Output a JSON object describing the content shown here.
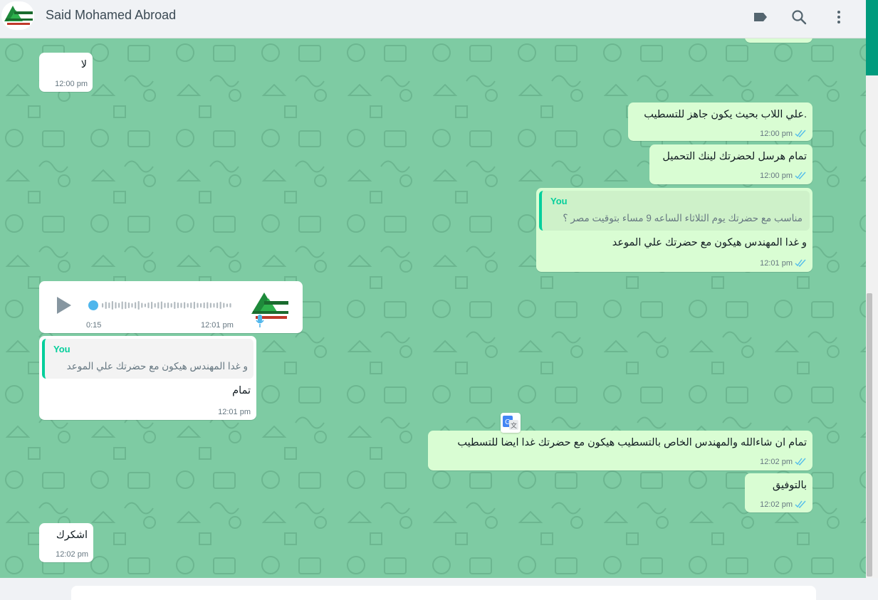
{
  "header": {
    "contact_name": "Said Mohamed Abroad",
    "icons": [
      "label-icon",
      "search-icon",
      "menu-icon"
    ]
  },
  "messages": [
    {
      "dir": "in",
      "text": "لا",
      "time": "12:00 pm"
    },
    {
      "dir": "out",
      "text": ".علي اللاب بحيث يكون جاهز للتسطيب",
      "time": "12:00 pm",
      "status": "read"
    },
    {
      "dir": "out",
      "text": "تمام هرسل لحضرتك لينك التحميل",
      "time": "12:00 pm",
      "status": "read"
    },
    {
      "dir": "out",
      "quote_author": "You",
      "quote_text": "مناسب مع حضرتك يوم الثلاثاء الساعه 9 مساء بتوقيت مصر ؟",
      "text": "و غدا المهندس هيكون مع حضرتك علي الموعد",
      "time": "12:01 pm",
      "status": "read"
    },
    {
      "dir": "in",
      "type": "voice",
      "duration": "0:15",
      "time": "12:01 pm"
    },
    {
      "dir": "in",
      "quote_author": "You",
      "quote_text": "و غدا المهندس هيكون مع حضرتك علي الموعد",
      "text": "تمام",
      "time": "12:01 pm"
    },
    {
      "dir": "out",
      "text": "تمام ان شاءالله والمهندس الخاص بالتسطيب هيكون مع حضرتك غدا ايضا للتسطيب",
      "time": "12:02 pm",
      "status": "read"
    },
    {
      "dir": "out",
      "text": "بالتوفيق",
      "time": "12:02 pm",
      "status": "read"
    },
    {
      "dir": "in",
      "text": "اشكرك",
      "time": "12:02 pm"
    }
  ],
  "colors": {
    "chat_bg": "#7ecba3",
    "outgoing": "#d9fdd3",
    "incoming": "#ffffff",
    "read_ticks": "#53bdeb",
    "accent": "#06cf9c"
  }
}
